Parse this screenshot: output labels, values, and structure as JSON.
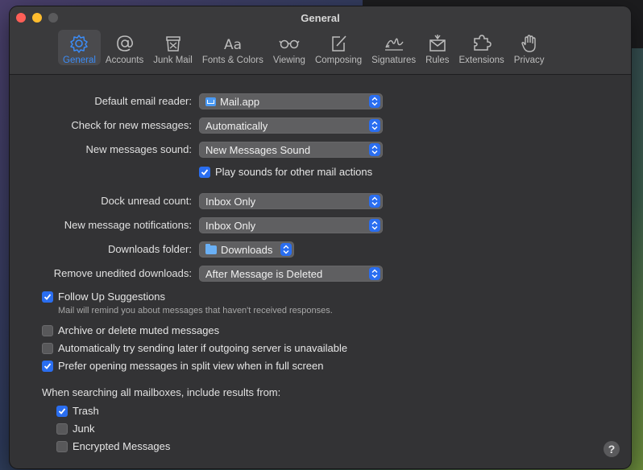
{
  "window": {
    "title": "General"
  },
  "toolbar": {
    "items": [
      {
        "label": "General",
        "icon": "gear-icon",
        "active": true
      },
      {
        "label": "Accounts",
        "icon": "at-sign-icon"
      },
      {
        "label": "Junk Mail",
        "icon": "junk-mail-icon"
      },
      {
        "label": "Fonts & Colors",
        "icon": "fonts-icon"
      },
      {
        "label": "Viewing",
        "icon": "glasses-icon"
      },
      {
        "label": "Composing",
        "icon": "compose-icon"
      },
      {
        "label": "Signatures",
        "icon": "signature-icon"
      },
      {
        "label": "Rules",
        "icon": "rules-icon"
      },
      {
        "label": "Extensions",
        "icon": "puzzle-icon"
      },
      {
        "label": "Privacy",
        "icon": "hand-icon"
      }
    ]
  },
  "settings": {
    "default_email_reader": {
      "label": "Default email reader:",
      "value": "Mail.app"
    },
    "check_new_messages": {
      "label": "Check for new messages:",
      "value": "Automatically"
    },
    "new_messages_sound": {
      "label": "New messages sound:",
      "value": "New Messages Sound"
    },
    "play_sounds": {
      "label": "Play sounds for other mail actions",
      "checked": true
    },
    "dock_unread_count": {
      "label": "Dock unread count:",
      "value": "Inbox Only"
    },
    "new_message_notifications": {
      "label": "New message notifications:",
      "value": "Inbox Only"
    },
    "downloads_folder": {
      "label": "Downloads folder:",
      "value": "Downloads"
    },
    "remove_unedited_downloads": {
      "label": "Remove unedited downloads:",
      "value": "After Message is Deleted"
    }
  },
  "options": {
    "follow_up": {
      "label": "Follow Up Suggestions",
      "checked": true,
      "note": "Mail will remind you about messages that haven't received responses."
    },
    "archive_muted": {
      "label": "Archive or delete muted messages",
      "checked": false
    },
    "try_sending_later": {
      "label": "Automatically try sending later if outgoing server is unavailable",
      "checked": false
    },
    "split_view": {
      "label": "Prefer opening messages in split view when in full screen",
      "checked": true
    }
  },
  "search": {
    "heading": "When searching all mailboxes, include results from:",
    "trash": {
      "label": "Trash",
      "checked": true
    },
    "junk": {
      "label": "Junk",
      "checked": false
    },
    "encrypted": {
      "label": "Encrypted Messages",
      "checked": false
    }
  },
  "help": {
    "label": "?"
  }
}
